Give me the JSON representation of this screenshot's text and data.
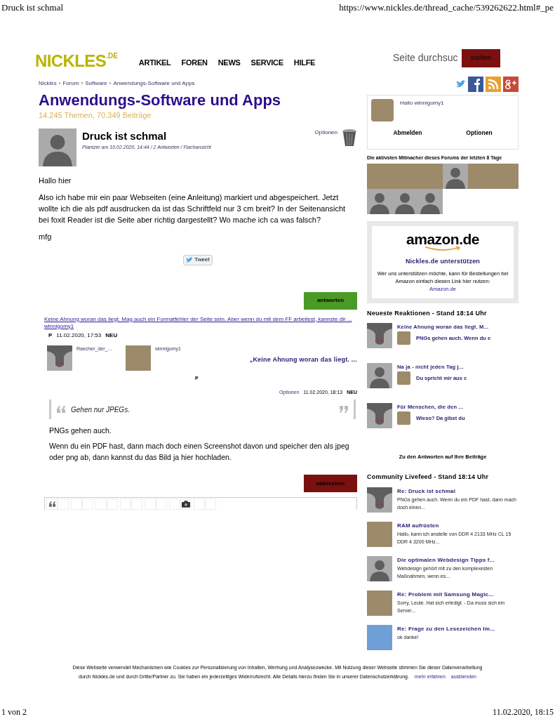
{
  "print_header": {
    "title": "Druck ist schmal",
    "url": "https://www.nickles.de/thread_cache/539262622.html#_pe"
  },
  "site_header": {
    "logo": "NICKLES",
    "logo_suffix": ".DE",
    "nav": [
      "ARTIKEL",
      "FOREN",
      "NEWS",
      "SERVICE",
      "HILFE"
    ],
    "search": {
      "placeholder": "Seite durchsuc"
    },
    "search_button": "suchen"
  },
  "breadcrumb": {
    "separator": "›",
    "items": [
      "Nickles",
      "Forum",
      "Software",
      "Anwendungs-Software und Apps"
    ]
  },
  "forum": {
    "title": "Anwendungs-Software und Apps",
    "stats": "14.245 Themen, 70.349 Beiträge"
  },
  "thread": {
    "title": "Druck ist schmal",
    "meta": "Plantzer am 10.02.2020, 14:44 / 2 Antworten / Flachansicht",
    "options": "Optionen",
    "paragraphs": [
      "Hallo hier",
      "Also ich habe mir ein paar Webseiten (eine Anleitung) markiert und abgespeichert. Jetzt wollte ich die als pdf ausdrucken da ist das Schriftfeld nur 3 cm breit? In der Seitenansicht bei foxit Reader ist die Seite aber richtig dargestellt? Wo mache ich ca was falsch?",
      "mfg"
    ],
    "tweet": "Tweet",
    "reply_button": "antworten"
  },
  "reply_tree": {
    "link": "Keine Ahnung woran das liegt. Mag auch ein Formatfehler der Seite sein. Aber wenn du mit dem FF arbeitest, kannste dir ...",
    "author": "winnigomy1",
    "flag": "P",
    "date": "11.02.2020, 17:53",
    "badge": "NEU"
  },
  "reply": {
    "users": [
      {
        "name": "Raecher_der_...",
        "kind": "ghost"
      },
      {
        "name": "winnigomy1",
        "kind": "photo"
      }
    ],
    "title": "„Keine Ahnung woran das liegt. ...",
    "flag": "P",
    "options": "Optionen",
    "date": "11.02.2020, 18:13",
    "badge": "NEU",
    "quote": "Gehen nur JPEGs.",
    "paragraphs": [
      "PNGs gehen auch.",
      "Wenn du ein PDF hast, dann mach doch einen Screenshot davon und speicher den als jpeg oder png ab, dann kannst du das Bild ja hier hochladen."
    ],
    "cancel_button": "abbrechen",
    "toolbar": [
      {
        "kind": "quote"
      },
      {
        "kind": "blank"
      },
      {
        "kind": "blank"
      },
      {
        "kind": "blank"
      },
      {
        "kind": "blank"
      },
      {
        "kind": "blank"
      },
      {
        "kind": "blank"
      },
      {
        "kind": "blank"
      },
      {
        "kind": "blank"
      },
      {
        "kind": "blank"
      },
      {
        "kind": "blank"
      },
      {
        "kind": "camera"
      },
      {
        "kind": "blank"
      },
      {
        "kind": "blank"
      }
    ]
  },
  "user_box": {
    "greeting": "Hallo winnigomy1",
    "actions": [
      "Abmelden",
      "Optionen"
    ]
  },
  "active_members": {
    "heading": "Die aktivsten Mitmacher dieses Forums der letzten 8 Tage",
    "avatars": [
      {
        "kind": "photo"
      },
      {
        "kind": "photo"
      },
      {
        "kind": "photo"
      },
      {
        "kind": "silhouette"
      },
      {
        "kind": "photo"
      },
      {
        "kind": "photo"
      },
      {
        "kind": "silhouette"
      },
      {
        "kind": "silhouette"
      },
      {
        "kind": "silhouette"
      }
    ]
  },
  "amazon": {
    "logo": "amazon.de",
    "heading": "Nickles.de unterstützen",
    "text": "Wer uns unterstützen möchte, kann für Bestellungen bei Amazon einfach diesen Link hier nutzen:",
    "link": "Amazon.de"
  },
  "reactions": {
    "heading": "Neueste Reaktionen - Stand 18:14 Uhr",
    "items": [
      {
        "kind": "ghost",
        "title": "Keine Ahnung woran das liegt. M...",
        "reply": "PNGs gehen auch. Wenn du e"
      },
      {
        "kind": "silhouette",
        "title": "Na ja - nicht jeden Tag j...",
        "reply": "Du spricht mir aus c"
      },
      {
        "kind": "ghost",
        "title": "Für Menschen, die den ...",
        "reply": "Wieso? Da gibst du"
      }
    ],
    "link": "Zu den Antworten auf Ihre Beiträge"
  },
  "livefeed": {
    "heading": "Community Livefeed - Stand 18:14 Uhr",
    "items": [
      {
        "kind": "ghost",
        "title": "Re: Druck ist schmal",
        "text": "PNGs gehen auch. Wenn du ein PDF hast, dann mach doch einen..."
      },
      {
        "kind": "photo",
        "title": "RAM aufrüsten",
        "text": "Hallo, kann ich anstelle von DDR 4 2133 MHz CL 15 DDR 4 3200 MHz..."
      },
      {
        "kind": "silhouette",
        "title": "Die optimalen Webdesign Tipps f...",
        "text": "Webdesign gehört mit zu den komplexesten Maßnahmen, wenn es..."
      },
      {
        "kind": "photo",
        "title": "Re: Problem mit Samsung Magic...",
        "text": "Sorry, Leute. Hat sich erledigt. - Da muss sich ein Server..."
      },
      {
        "kind": "sky",
        "title": "Re: Frage zu den Lesezeichen Im...",
        "text": "ok danke!"
      }
    ]
  },
  "cookie_banner": {
    "text": "Diese Webseite verwendet Mechanismen wie Cookies zur Personalisierung von Inhalten, Werbung und Analysezwecke. Mit Nutzung dieser Webseite stimmen Sie dieser Datenverarbeitung durch Nickles.de und durch Dritte/Partner zu. Sie haben ein jederzeitiges Widerrufsrecht. Alle Details hierzu finden Sie in unserer Datenschutzerklärung.",
    "links": [
      "mehr erfahren",
      "ausblenden"
    ]
  },
  "print_footer": {
    "page": "1 von 2",
    "date": "11.02.2020, 18:15"
  }
}
